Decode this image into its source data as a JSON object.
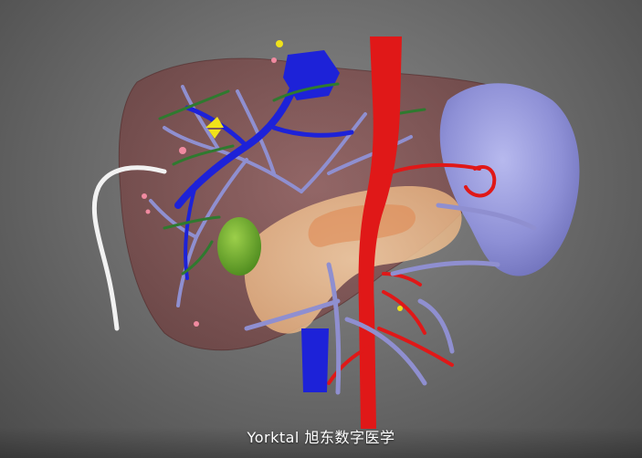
{
  "image": {
    "caption": "Yorktal 旭东数字医学"
  }
}
